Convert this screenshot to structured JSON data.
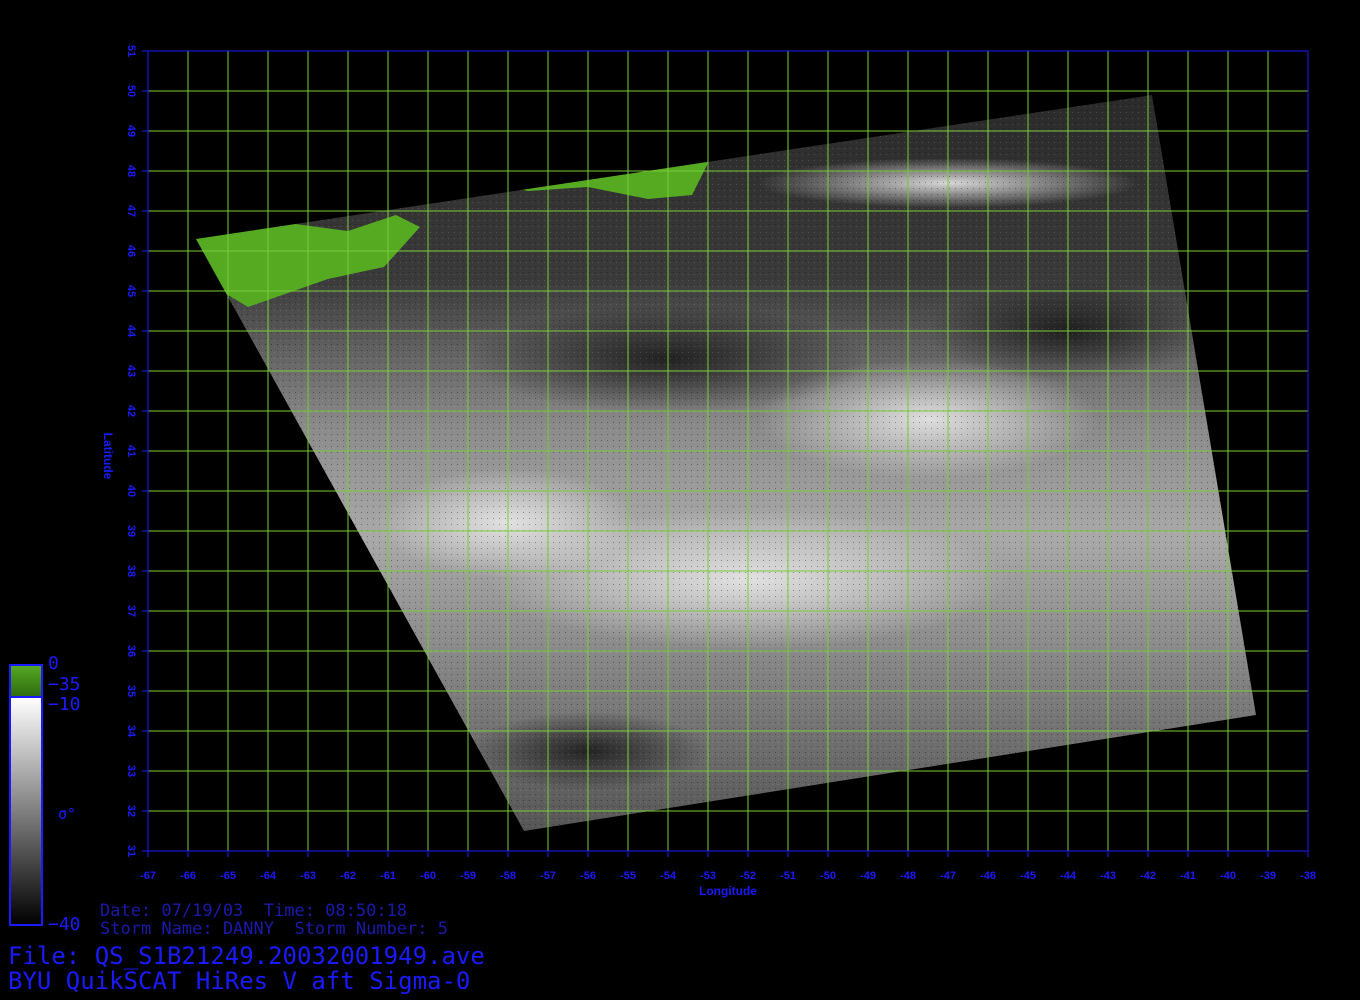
{
  "map": {
    "axes": {
      "xlabel": "Longitude",
      "ylabel": "Latitude",
      "xlim": [
        -67,
        -38
      ],
      "ylim": [
        31,
        51
      ],
      "x_ticks": [
        "-67",
        "-66",
        "-65",
        "-64",
        "-63",
        "-62",
        "-61",
        "-60",
        "-59",
        "-58",
        "-57",
        "-56",
        "-55",
        "-54",
        "-53",
        "-52",
        "-51",
        "-50",
        "-49",
        "-48",
        "-47",
        "-46",
        "-45",
        "-44",
        "-43",
        "-42",
        "-41",
        "-40",
        "-39",
        "-38"
      ],
      "y_ticks": [
        "31",
        "32",
        "33",
        "34",
        "35",
        "36",
        "37",
        "38",
        "39",
        "40",
        "41",
        "42",
        "43",
        "44",
        "45",
        "46",
        "47",
        "48",
        "49",
        "50",
        "51"
      ],
      "grid": true,
      "grid_color": "#7acc3a",
      "axis_color": "#1a1aff"
    },
    "swath_corners": [
      {
        "lon": -65.8,
        "lat": 46.3
      },
      {
        "lon": -41.9,
        "lat": 49.9
      },
      {
        "lon": -39.3,
        "lat": 34.4
      },
      {
        "lon": -57.6,
        "lat": 31.5
      }
    ],
    "land_color": "#55aa22"
  },
  "colorbar": {
    "label": "σ°",
    "top_value": "0",
    "land_threshold": "−35",
    "upper_value": "−10",
    "bottom_value": "−40",
    "land_color": "#55aa22"
  },
  "info": {
    "date_line": "Date: 07/19/03  Time: 08:50:18",
    "storm_line": "Storm Name: DANNY  Storm Number: 5",
    "file_line": "File: QS_S1B21249.20032001949.ave",
    "title_line": "BYU QuikSCAT HiRes V aft Sigma-0"
  }
}
